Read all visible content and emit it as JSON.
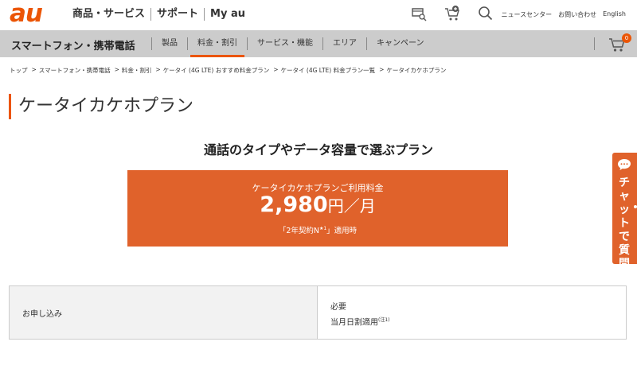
{
  "header": {
    "logo": "au",
    "nav": [
      "商品・サービス",
      "サポート",
      "My au"
    ],
    "icons": [
      "shop-search-icon",
      "cart-plus-icon",
      "search-icon"
    ],
    "links": [
      "ニュースセンター",
      "お問い合わせ",
      "English"
    ]
  },
  "subnav": {
    "section_title": "スマートフォン・携帯電話",
    "items": [
      "製品",
      "料金・割引",
      "サービス・機能",
      "エリア",
      "キャンペーン"
    ],
    "active_index": 1,
    "cart_count": "0"
  },
  "breadcrumb": [
    "トップ",
    "スマートフォン・携帯電話",
    "料金・割引",
    "ケータイ (4G LTE) おすすめ料金プラン",
    "ケータイ (4G LTE) 料金プラン一覧",
    "ケータイカケホプラン"
  ],
  "page_title": "ケータイカケホプラン",
  "plan_heading": "通話のタイプやデータ容量で選ぶプラン",
  "price_box": {
    "label": "ケータイカケホプランご利用料金",
    "amount": "2,980",
    "unit": "円／月",
    "note_prefix": "「2年契約N",
    "note_sup": "★1",
    "note_suffix": "」適用時"
  },
  "apply_table": {
    "header": "お申し込み",
    "value_line1": "必要",
    "value_line2": "当月日割適用",
    "value_sup": "(注1)"
  },
  "chat": {
    "label": "チャットで質問"
  },
  "colors": {
    "brand": "#eb5505",
    "price_box": "#e0622b",
    "subnav_bg": "#cccccc"
  }
}
